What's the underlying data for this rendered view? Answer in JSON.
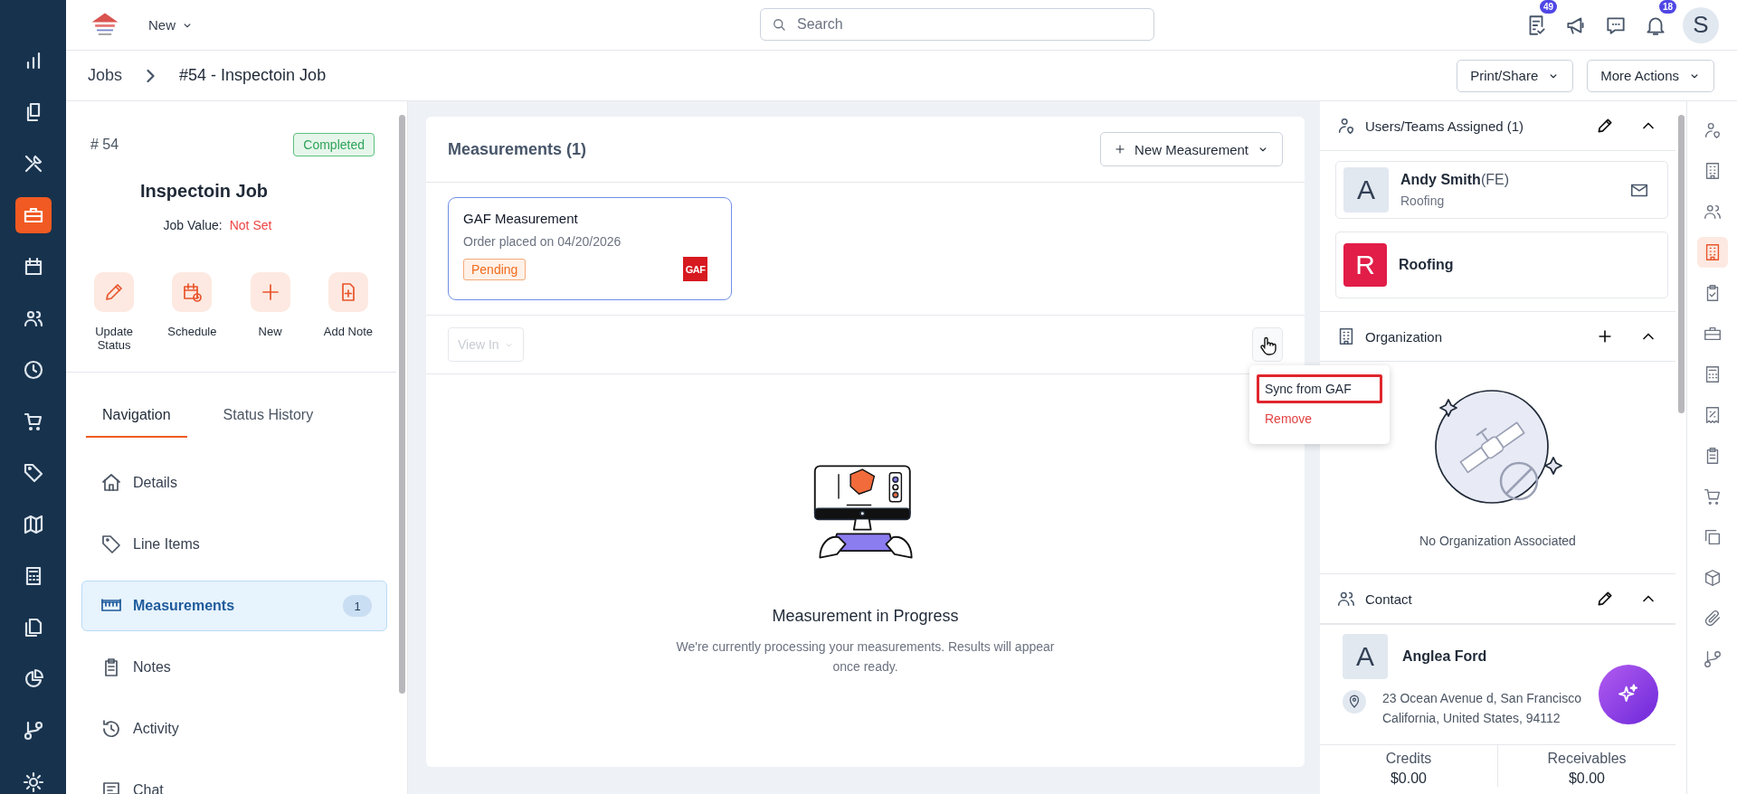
{
  "app_nav": [
    {
      "kind": "bar-chart",
      "selected": false
    },
    {
      "kind": "documents",
      "selected": false
    },
    {
      "kind": "tools",
      "selected": false
    },
    {
      "kind": "briefcase",
      "selected": true
    },
    {
      "kind": "calendar",
      "selected": false
    },
    {
      "kind": "users",
      "selected": false
    },
    {
      "kind": "clock",
      "selected": false
    },
    {
      "kind": "cart",
      "selected": false
    },
    {
      "kind": "tag",
      "selected": false
    },
    {
      "kind": "map",
      "selected": false
    },
    {
      "kind": "calculator",
      "selected": false
    },
    {
      "kind": "files",
      "selected": false
    },
    {
      "kind": "pie-chart",
      "selected": false
    },
    {
      "kind": "branch",
      "selected": false
    },
    {
      "kind": "gear",
      "selected": false
    }
  ],
  "topbar": {
    "new_menu": "New",
    "search": {
      "placeholder": "Search"
    },
    "task_badge": "49",
    "notification_badge": "18",
    "avatar": "S"
  },
  "breadcrumb": [
    "Jobs",
    "#54 - Inspectoin Job"
  ],
  "actions": [
    "Print/Share",
    "More Actions"
  ],
  "job": {
    "number": "# 54",
    "status": "Completed",
    "title": "Inspectoin Job",
    "value_label": "Job Value:",
    "value": "Not Set"
  },
  "quick_actions": [
    {
      "kind": "pencil",
      "label": "Update Status"
    },
    {
      "kind": "calendar-clock",
      "label": "Schedule"
    },
    {
      "kind": "plus",
      "label": "New"
    },
    {
      "kind": "file-plus",
      "label": "Add Note"
    }
  ],
  "tabs": [
    {
      "label": "Navigation",
      "selected": true
    },
    {
      "label": "Status History",
      "selected": false
    }
  ],
  "nav": [
    {
      "kind": "home",
      "label": "Details",
      "selected": false
    },
    {
      "kind": "tag",
      "label": "Line Items",
      "selected": false
    },
    {
      "kind": "ruler",
      "label": "Measurements",
      "count": "1",
      "selected": true
    },
    {
      "kind": "clipboard",
      "label": "Notes",
      "selected": false
    },
    {
      "kind": "history",
      "label": "Activity",
      "selected": false
    },
    {
      "kind": "chat",
      "label": "Chat",
      "selected": false
    }
  ],
  "measurements": {
    "title": "Measurements (1)",
    "new_button": "New Measurement",
    "items": [
      {
        "name": "GAF Measurement",
        "ordered": "Order placed on 04/20/2026",
        "status": "Pending",
        "provider": "GAF"
      }
    ],
    "view_in": {
      "label": "View In",
      "disabled": true
    },
    "menu": [
      {
        "label": "Sync from GAF",
        "kind": "normal",
        "highlighted": true
      },
      {
        "label": "Remove",
        "kind": "danger",
        "highlighted": false
      }
    ],
    "empty": {
      "title": "Measurement in Progress",
      "text": "We're currently processing your measurements. Results will appear once ready."
    }
  },
  "right_panel": {
    "assigned": {
      "title": "Users/Teams Assigned (1)",
      "members": [
        {
          "kind": "user",
          "initial": "A",
          "name": "Andy Smith",
          "tag": "(FE)",
          "subtitle": "Roofing"
        },
        {
          "kind": "team",
          "initial": "R",
          "name": "Roofing"
        }
      ]
    },
    "organization": {
      "title": "Organization",
      "empty": "No Organization Associated"
    },
    "contact": {
      "title": "Contact",
      "initial": "A",
      "name": "Anglea Ford",
      "address": [
        "23 Ocean Avenue d, San Francisco",
        "California, United States, 94112"
      ]
    },
    "balances": [
      {
        "label": "Credits",
        "value": "$0.00"
      },
      {
        "label": "Receivables",
        "value": "$0.00"
      }
    ]
  },
  "side_rail": [
    {
      "kind": "user-pin",
      "selected": false
    },
    {
      "kind": "building",
      "selected": false
    },
    {
      "kind": "users",
      "selected": false
    },
    {
      "kind": "building",
      "selected": true
    },
    {
      "kind": "clipboard-check",
      "selected": false
    },
    {
      "kind": "briefcase",
      "selected": false
    },
    {
      "kind": "calculator",
      "selected": false
    },
    {
      "kind": "receipt",
      "selected": false
    },
    {
      "kind": "clipboard",
      "selected": false
    },
    {
      "kind": "cart",
      "selected": false
    },
    {
      "kind": "copy",
      "selected": false
    },
    {
      "kind": "cube",
      "selected": false
    },
    {
      "kind": "paperclip",
      "selected": false
    },
    {
      "kind": "branch",
      "selected": false
    }
  ]
}
